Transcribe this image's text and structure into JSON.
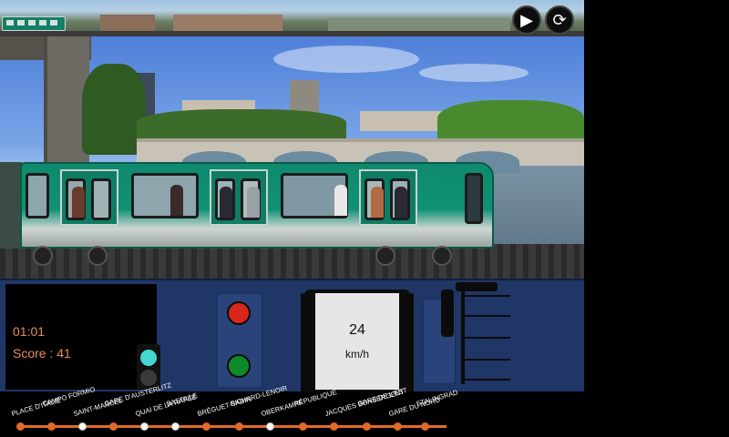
{
  "controls": {
    "play_icon": "play-icon",
    "restart_icon": "restart-icon",
    "play_glyph": "▶",
    "restart_glyph": "⟳"
  },
  "status": {
    "time": "01:01",
    "score": "Score : 41"
  },
  "speed": {
    "value": "24",
    "unit": "km/h"
  },
  "stations": [
    "PLACE D'ITALIE",
    "CAMPO FORMIO",
    "SAINT-MARCEL",
    "GARE D'AUSTERLITZ",
    "QUAI DE LA RAPÉE",
    "BASTILLE",
    "BRÉGUET-SABIN",
    "RICHARD-LENOIR",
    "OBERKAMPF",
    "RÉPUBLIQUE",
    "JACQUES BONSERGENT",
    "GARE DE L'EST",
    "GARE DU NORD",
    "STALINGRAD"
  ],
  "colors": {
    "train": "#109174",
    "dashboard": "#1f3667",
    "line": "#e06a2a",
    "status_text": "#e58e52",
    "signal_red": "#d9261c",
    "signal_green": "#0f8a2a",
    "signal_cyan": "#45d6d0"
  }
}
